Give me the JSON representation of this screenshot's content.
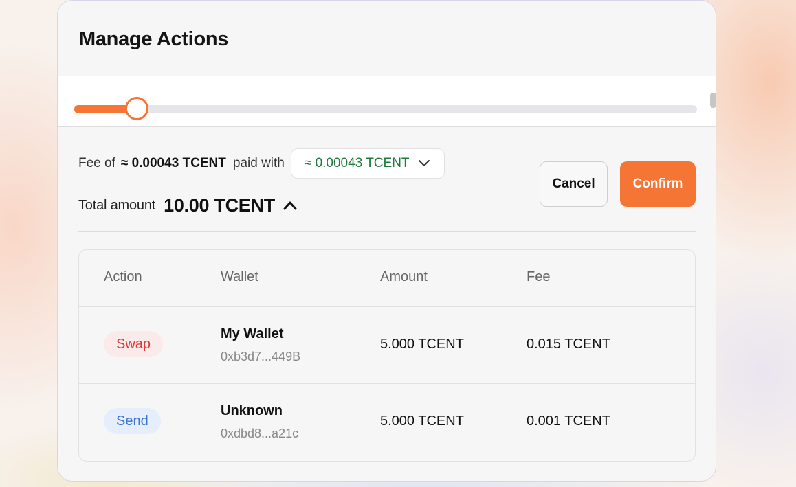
{
  "modal": {
    "title": "Manage Actions"
  },
  "slider": {
    "level_percent": 10
  },
  "fee": {
    "label": "Fee of",
    "value": "≈ 0.00043 TCENT",
    "paid_with_label": "paid with",
    "selected_token": "≈ 0.00043 TCENT"
  },
  "total": {
    "label": "Total amount",
    "value": "10.00 TCENT"
  },
  "buttons": {
    "cancel": "Cancel",
    "confirm": "Confirm"
  },
  "table": {
    "columns": [
      "Action",
      "Wallet",
      "Amount",
      "Fee"
    ],
    "rows": [
      {
        "action": "Swap",
        "wallet_name": "My Wallet",
        "wallet_address": "0xb3d7...449B",
        "amount": "5.000 TCENT",
        "fee": "0.015 TCENT"
      },
      {
        "action": "Send",
        "wallet_name": "Unknown",
        "wallet_address": "0xdbd8...a21c",
        "amount": "5.000 TCENT",
        "fee": "0.001 TCENT"
      }
    ]
  },
  "colors": {
    "accent": "#f57535",
    "fee_token_text": "#1f7a3c",
    "swap_text": "#d93a3a",
    "swap_bg": "#fbeaea",
    "send_text": "#3b72d4",
    "send_bg": "#e6eefb"
  },
  "icons": {
    "fee_select": "chevron-down-icon",
    "total_toggle": "chevron-up-icon"
  }
}
